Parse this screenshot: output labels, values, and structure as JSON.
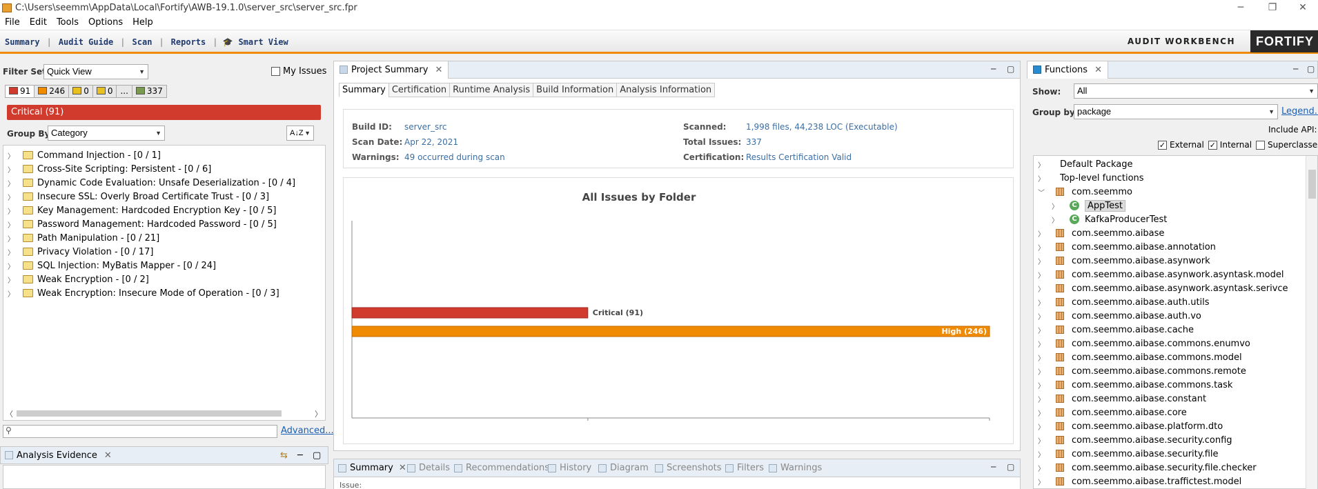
{
  "window": {
    "title": "C:\\Users\\seemm\\AppData\\Local\\Fortify\\AWB-19.1.0\\server_src\\server_src.fpr",
    "minimize": "─",
    "restore": "❐",
    "close": "✕"
  },
  "menu": [
    "File",
    "Edit",
    "Tools",
    "Options",
    "Help"
  ],
  "toolbar": {
    "links": [
      "Summary",
      "Audit Guide",
      "Scan",
      "Reports",
      "Smart View"
    ],
    "product": "AUDIT WORKBENCH",
    "logo": "FORTIFY"
  },
  "colors": {
    "critical": "#d03b2e",
    "high": "#f08a00",
    "medium": "#e8c020",
    "low": "#e8c020",
    "all": "#7a9a50",
    "link": "#3a6ea5"
  },
  "left": {
    "filter_set_label": "Filter Set:",
    "filter_set_value": "Quick View",
    "my_issues_label": "My Issues",
    "counts": [
      {
        "label": "91",
        "icon": "critical-square"
      },
      {
        "label": "246",
        "icon": "high-square"
      },
      {
        "label": "0",
        "icon": "medium-square"
      },
      {
        "label": "0",
        "icon": "low-square"
      },
      {
        "label": "...",
        "icon": ""
      },
      {
        "label": "337",
        "icon": "all-square"
      }
    ],
    "critical_header": "Critical (91)",
    "group_by_label": "Group By:",
    "group_by_value": "Category",
    "sort_icon": "A↓Z",
    "categories": [
      "Command Injection - [0 / 1]",
      "Cross-Site Scripting: Persistent - [0 / 6]",
      "Dynamic Code Evaluation: Unsafe Deserialization - [0 / 4]",
      "Insecure SSL: Overly Broad Certificate Trust - [0 / 3]",
      "Key Management: Hardcoded Encryption Key - [0 / 5]",
      "Password Management: Hardcoded Password - [0 / 5]",
      "Path Manipulation - [0 / 21]",
      "Privacy Violation - [0 / 17]",
      "SQL Injection: MyBatis Mapper - [0 / 24]",
      "Weak Encryption - [0 / 2]",
      "Weak Encryption: Insecure Mode of Operation - [0 / 3]"
    ],
    "advanced_link": "Advanced...",
    "evidence_title": "Analysis Evidence"
  },
  "center": {
    "panel_title": "Project Summary",
    "tabs": [
      "Summary",
      "Certification",
      "Runtime Analysis",
      "Build Information",
      "Analysis Information"
    ],
    "info": {
      "build_id_label": "Build ID:",
      "build_id": "server_src",
      "scan_date_label": "Scan Date:",
      "scan_date": "Apr 22, 2021",
      "warnings_label": "Warnings:",
      "warnings": "49 occurred during scan",
      "scanned_label": "Scanned:",
      "scanned": "1,998 files, 44,238 LOC (Executable)",
      "total_issues_label": "Total Issues:",
      "total_issues": "337",
      "certification_label": "Certification:",
      "certification": "Results Certification Valid"
    },
    "bottom_tabs": [
      "Summary",
      "Details",
      "Recommendations",
      "History",
      "Diagram",
      "Screenshots",
      "Filters",
      "Warnings"
    ],
    "issue_label": "Issue:"
  },
  "chart_data": {
    "type": "bar",
    "orientation": "horizontal",
    "title": "All Issues by Folder",
    "categories": [
      "Critical",
      "High"
    ],
    "values": [
      91,
      246
    ],
    "labels": [
      "Critical (91)",
      "High (246)"
    ],
    "colors": [
      "#d03b2e",
      "#f08a00"
    ],
    "xlim": [
      0,
      246
    ]
  },
  "right": {
    "panel_title": "Functions",
    "show_label": "Show:",
    "show_value": "All",
    "group_by_label": "Group by:",
    "group_by_value": "package",
    "legend_link": "Legend...",
    "include_api_label": "Include API:",
    "checkboxes": [
      {
        "label": "External",
        "checked": true
      },
      {
        "label": "Internal",
        "checked": true
      },
      {
        "label": "Superclasses",
        "checked": false
      }
    ],
    "tree": [
      {
        "label": "Default Package",
        "level": 0,
        "kind": "none",
        "expanded": false
      },
      {
        "label": "Top-level functions",
        "level": 0,
        "kind": "none",
        "expanded": false
      },
      {
        "label": "com.seemmo",
        "level": 0,
        "kind": "package",
        "expanded": true
      },
      {
        "label": "AppTest",
        "level": 1,
        "kind": "class",
        "expanded": false,
        "selected": true
      },
      {
        "label": "KafkaProducerTest",
        "level": 1,
        "kind": "class",
        "expanded": false
      },
      {
        "label": "com.seemmo.aibase",
        "level": 0,
        "kind": "package"
      },
      {
        "label": "com.seemmo.aibase.annotation",
        "level": 0,
        "kind": "package"
      },
      {
        "label": "com.seemmo.aibase.asynwork",
        "level": 0,
        "kind": "package"
      },
      {
        "label": "com.seemmo.aibase.asynwork.asyntask.model",
        "level": 0,
        "kind": "package"
      },
      {
        "label": "com.seemmo.aibase.asynwork.asyntask.serivce",
        "level": 0,
        "kind": "package"
      },
      {
        "label": "com.seemmo.aibase.auth.utils",
        "level": 0,
        "kind": "package"
      },
      {
        "label": "com.seemmo.aibase.auth.vo",
        "level": 0,
        "kind": "package"
      },
      {
        "label": "com.seemmo.aibase.cache",
        "level": 0,
        "kind": "package"
      },
      {
        "label": "com.seemmo.aibase.commons.enumvo",
        "level": 0,
        "kind": "package"
      },
      {
        "label": "com.seemmo.aibase.commons.model",
        "level": 0,
        "kind": "package"
      },
      {
        "label": "com.seemmo.aibase.commons.remote",
        "level": 0,
        "kind": "package"
      },
      {
        "label": "com.seemmo.aibase.commons.task",
        "level": 0,
        "kind": "package"
      },
      {
        "label": "com.seemmo.aibase.constant",
        "level": 0,
        "kind": "package"
      },
      {
        "label": "com.seemmo.aibase.core",
        "level": 0,
        "kind": "package"
      },
      {
        "label": "com.seemmo.aibase.platform.dto",
        "level": 0,
        "kind": "package"
      },
      {
        "label": "com.seemmo.aibase.security.config",
        "level": 0,
        "kind": "package"
      },
      {
        "label": "com.seemmo.aibase.security.file",
        "level": 0,
        "kind": "package"
      },
      {
        "label": "com.seemmo.aibase.security.file.checker",
        "level": 0,
        "kind": "package"
      },
      {
        "label": "com.seemmo.aibase.traffictest.model",
        "level": 0,
        "kind": "package"
      }
    ]
  }
}
